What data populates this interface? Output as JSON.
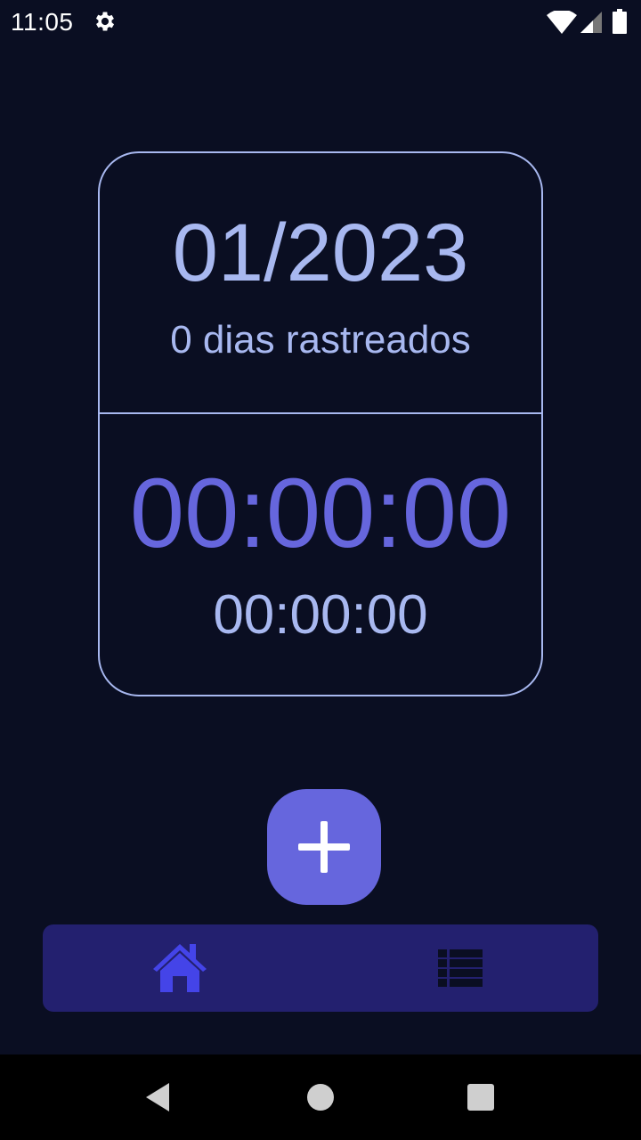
{
  "status_bar": {
    "time": "11:05",
    "icons": [
      "gear-icon",
      "wifi-icon",
      "cell-signal-icon",
      "battery-icon"
    ]
  },
  "card": {
    "month_year": "01/2023",
    "days_tracked": "0 dias rastreados",
    "timer_main": "00:00:00",
    "timer_sub": "00:00:00"
  },
  "fab": {
    "icon": "plus-icon"
  },
  "bottom_nav": {
    "items": [
      {
        "icon": "home-icon",
        "active": true
      },
      {
        "icon": "list-icon",
        "active": false
      }
    ]
  },
  "colors": {
    "background": "#0a0e22",
    "accent": "#6666dd",
    "text_light": "#a8b8f0",
    "nav_bg": "#23206f",
    "home_icon": "#4444e8",
    "list_icon": "#0a0e22"
  }
}
